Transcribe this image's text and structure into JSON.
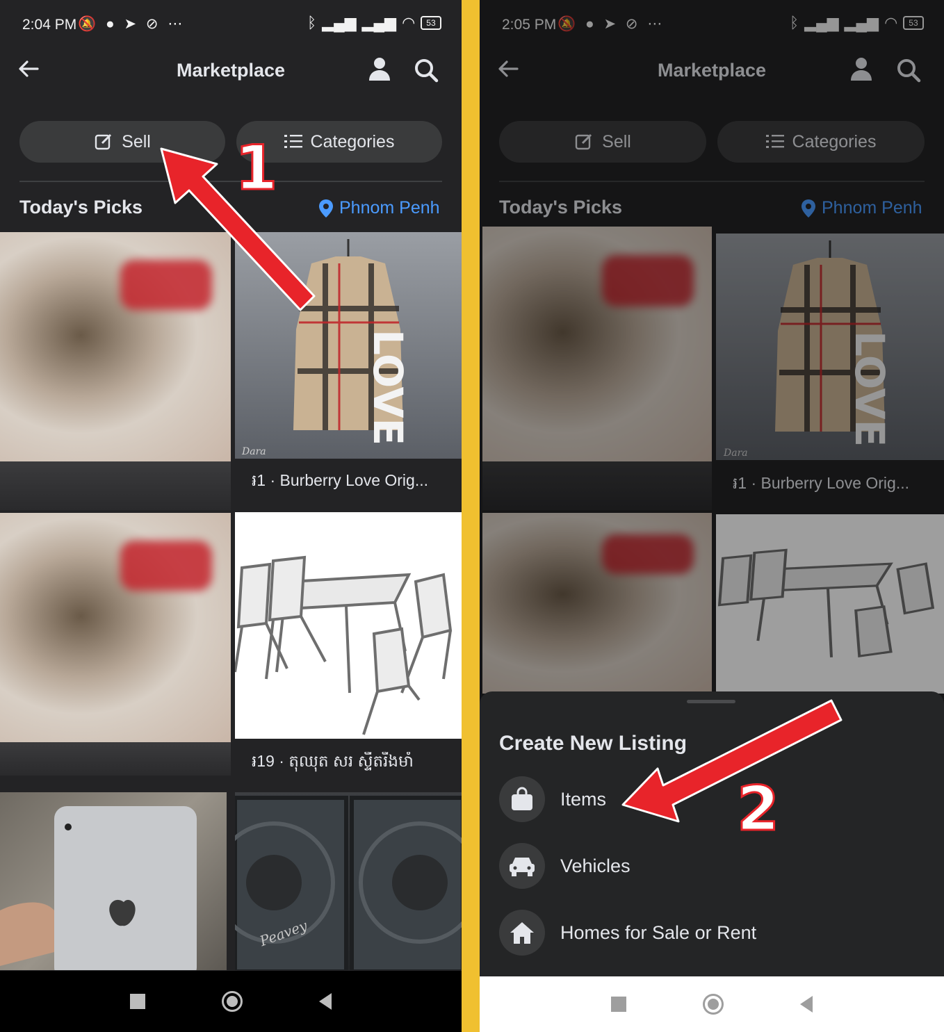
{
  "left": {
    "status": {
      "time": "2:04 PM",
      "extra_icons": "⋯",
      "battery": "53"
    },
    "header": {
      "title": "Marketplace"
    },
    "buttons": {
      "sell": "Sell",
      "categories": "Categories"
    },
    "picks": {
      "title": "Today's Picks",
      "location": "Phnom Penh"
    },
    "listings": [
      {
        "caption": "៛1 · Burberry Love Orig..."
      },
      {
        "caption": "៛19 · តុឈុត សរ ស្ទីតរឹងមាំ"
      }
    ]
  },
  "right": {
    "status": {
      "time": "2:05 PM",
      "extra_icons": "⋯",
      "battery": "53"
    },
    "header": {
      "title": "Marketplace"
    },
    "buttons": {
      "sell": "Sell",
      "categories": "Categories"
    },
    "picks": {
      "title": "Today's Picks",
      "location": "Phnom Penh"
    },
    "listings": [
      {
        "caption": "៛1 · Burberry Love Orig..."
      }
    ],
    "sheet": {
      "title": "Create New Listing",
      "options": [
        {
          "label": "Items",
          "icon": "shopping-bag-icon"
        },
        {
          "label": "Vehicles",
          "icon": "car-icon"
        },
        {
          "label": "Homes for Sale or Rent",
          "icon": "house-icon"
        }
      ]
    }
  },
  "annotations": {
    "step1": "1",
    "step2": "2",
    "arrow_color": "#e8242a"
  }
}
